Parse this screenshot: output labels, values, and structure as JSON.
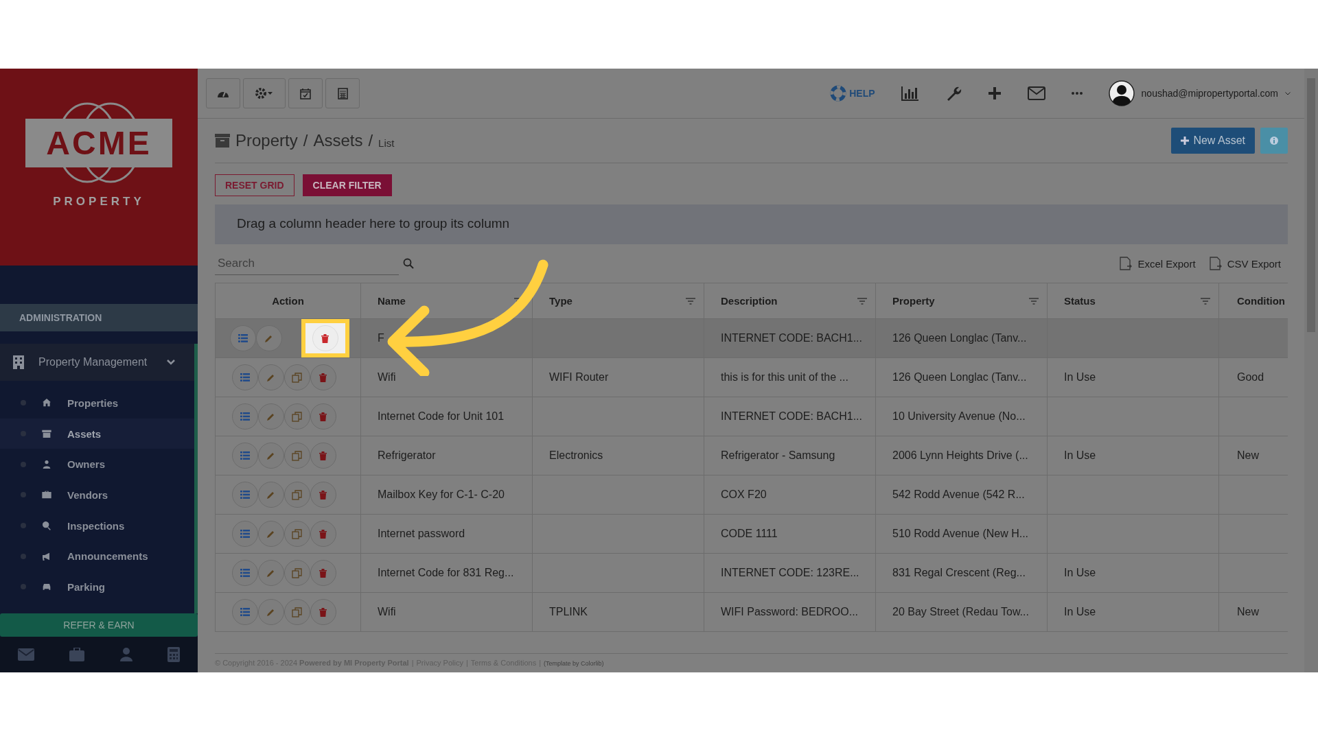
{
  "logo": {
    "title": "ACME",
    "subtitle": "PROPERTY"
  },
  "sidebar": {
    "section": "ADMINISTRATION",
    "group": {
      "label": "Property Management",
      "expanded": true
    },
    "items": [
      {
        "label": "Properties",
        "selected": false
      },
      {
        "label": "Assets",
        "selected": true
      },
      {
        "label": "Owners",
        "selected": false
      },
      {
        "label": "Vendors",
        "selected": false
      },
      {
        "label": "Inspections",
        "selected": false
      },
      {
        "label": "Announcements",
        "selected": false
      },
      {
        "label": "Parking",
        "selected": false
      }
    ],
    "refer_button": "REFER & EARN"
  },
  "header": {
    "help": "HELP",
    "user": "noushad@mipropertyportal.com"
  },
  "breadcrumb": {
    "separator": "/",
    "items": [
      "Property",
      "Assets",
      "List"
    ]
  },
  "new_asset_button": "New Asset",
  "grid_buttons": {
    "reset": "RESET GRID",
    "clear": "CLEAR FILTER"
  },
  "group_panel": "Drag a column header here to group its column",
  "search": {
    "placeholder": "Search"
  },
  "exports": [
    "Excel Export",
    "CSV Export"
  ],
  "table": {
    "columns": [
      {
        "label": "Action",
        "filter": false
      },
      {
        "label": "Name",
        "filter": true
      },
      {
        "label": "Type",
        "filter": true
      },
      {
        "label": "Description",
        "filter": true
      },
      {
        "label": "Property",
        "filter": true
      },
      {
        "label": "Status",
        "filter": true
      },
      {
        "label": "Condition"
      }
    ],
    "rows": [
      {
        "selected": true,
        "delete_highlighted": true,
        "cells": [
          "",
          "F",
          "",
          "INTERNET CODE: BACH1...",
          "126 Queen Longlac (Tanv...",
          "",
          ""
        ]
      },
      {
        "selected": false,
        "delete_highlighted": false,
        "cells": [
          "",
          "Wifi",
          "WIFI Router",
          "this is for this unit of the ...",
          "126 Queen Longlac (Tanv...",
          "In Use",
          "Good"
        ]
      },
      {
        "selected": false,
        "delete_highlighted": false,
        "cells": [
          "",
          "Internet Code for Unit 101",
          "",
          "INTERNET CODE: BACH1...",
          "10 University Avenue (No...",
          "",
          ""
        ]
      },
      {
        "selected": false,
        "delete_highlighted": false,
        "cells": [
          "",
          "Refrigerator",
          "Electronics",
          "Refrigerator - Samsung",
          "2006 Lynn Heights Drive (...",
          "In Use",
          "New"
        ]
      },
      {
        "selected": false,
        "delete_highlighted": false,
        "cells": [
          "",
          "Mailbox Key for C-1- C-20",
          "",
          "COX F20",
          "542 Rodd Avenue (542 R...",
          "",
          ""
        ]
      },
      {
        "selected": false,
        "delete_highlighted": false,
        "cells": [
          "",
          "Internet password",
          "",
          "CODE 1111",
          "510 Rodd Avenue (New H...",
          "",
          ""
        ]
      },
      {
        "selected": false,
        "delete_highlighted": false,
        "cells": [
          "",
          "Internet Code for 831 Reg...",
          "",
          "INTERNET CODE: 123RE...",
          "831 Regal Crescent (Reg...",
          "In Use",
          ""
        ]
      },
      {
        "selected": false,
        "delete_highlighted": false,
        "cells": [
          "",
          "Wifi",
          "TPLINK",
          "WIFI Password: BEDROO...",
          "20 Bay Street (Redau Tow...",
          "In Use",
          "New"
        ]
      }
    ]
  },
  "footer": {
    "separator": "|",
    "copyright": "© Copyright 2016 - 2024 **Powered by MI Property Portal**",
    "links": [
      "Privacy Policy",
      "Terms & Conditions"
    ],
    "template": "(Template by Colorlib)"
  }
}
